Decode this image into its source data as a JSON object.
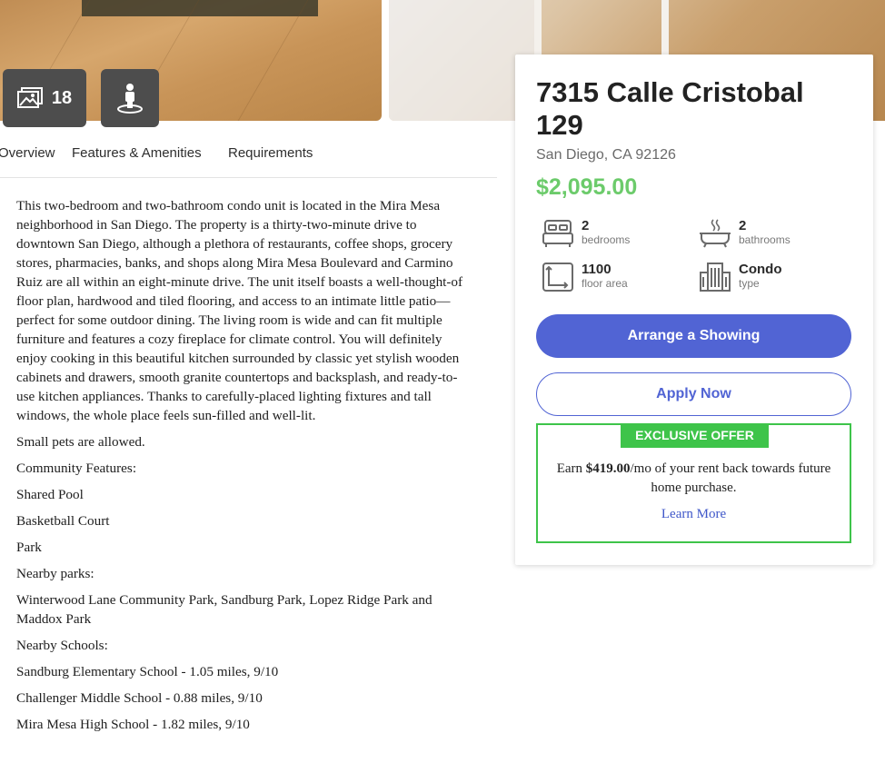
{
  "gallery": {
    "photo_count": "18"
  },
  "tabs": [
    "Overview",
    "Features & Amenities",
    "Requirements"
  ],
  "description": {
    "paragraphs": [
      "This two-bedroom and two-bathroom condo unit is located in the Mira Mesa neighborhood in San Diego. The property is a thirty-two-minute drive to downtown San Diego, although a plethora of restaurants, coffee shops, grocery stores, pharmacies, banks, and shops along Mira Mesa Boulevard and Carmino Ruiz are all within an eight-minute drive. The unit itself boasts a well-thought-of floor plan, hardwood and tiled flooring, and access to an intimate little patio—perfect for some outdoor dining. The living room is wide and can fit multiple furniture and features a cozy fireplace for climate control. You will definitely enjoy cooking in this beautiful kitchen surrounded by classic yet stylish wooden cabinets and drawers, smooth granite countertops and backsplash, and ready-to-use kitchen appliances. Thanks to carefully-placed lighting fixtures and tall windows, the whole place feels sun-filled and well-lit.",
      "Small pets are allowed.",
      "Community Features:",
      "Shared Pool",
      "Basketball Court",
      "Park",
      "Nearby parks:",
      "Winterwood Lane Community Park, Sandburg Park, Lopez Ridge Park and Maddox Park",
      "Nearby Schools:",
      "Sandburg Elementary School - 1.05 miles, 9/10",
      "Challenger Middle School - 0.88 miles, 9/10",
      "Mira Mesa High School - 1.82 miles, 9/10"
    ]
  },
  "listing": {
    "address": "7315 Calle Cristobal 129",
    "city": "San Diego, CA 92126",
    "price": "$2,095.00",
    "specs": {
      "bedrooms": {
        "value": "2",
        "label": "bedrooms"
      },
      "bathrooms": {
        "value": "2",
        "label": "bathrooms"
      },
      "area": {
        "value": "1100",
        "label": "floor area"
      },
      "type": {
        "value": "Condo",
        "label": "type"
      }
    },
    "primary_button": "Arrange a Showing",
    "secondary_button": "Apply Now"
  },
  "offer": {
    "tag": "EXCLUSIVE OFFER",
    "prefix": "Earn ",
    "amount": "$419.00",
    "suffix": "/mo of your rent back towards future home purchase.",
    "link": "Learn More"
  },
  "colors": {
    "accent": "#5164d4",
    "price": "#6ccb6b",
    "offer": "#3ec44a"
  }
}
